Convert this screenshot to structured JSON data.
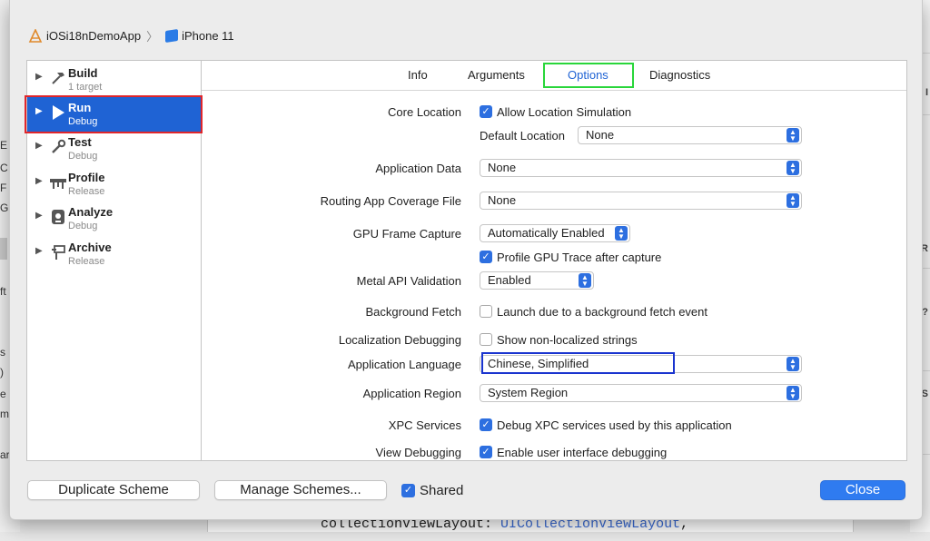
{
  "breadcrumb": {
    "project": "iOSi18nDemoApp",
    "device": "iPhone 11"
  },
  "sidebar": {
    "actions": [
      {
        "name": "Build",
        "sub": "1 target",
        "icon": "hammer-icon"
      },
      {
        "name": "Run",
        "sub": "Debug",
        "icon": "play-icon",
        "selected": true
      },
      {
        "name": "Test",
        "sub": "Debug",
        "icon": "wrench-icon"
      },
      {
        "name": "Profile",
        "sub": "Release",
        "icon": "caliper-icon"
      },
      {
        "name": "Analyze",
        "sub": "Debug",
        "icon": "analyze-icon"
      },
      {
        "name": "Archive",
        "sub": "Release",
        "icon": "archive-icon"
      }
    ]
  },
  "tabs": {
    "info": "Info",
    "arguments": "Arguments",
    "options": "Options",
    "diagnostics": "Diagnostics",
    "active": "Options"
  },
  "options": {
    "core_location": {
      "label": "Core Location",
      "checkbox": "Allow Location Simulation",
      "checked": true
    },
    "default_location": {
      "label": "Default Location",
      "value": "None"
    },
    "application_data": {
      "label": "Application Data",
      "value": "None"
    },
    "routing": {
      "label": "Routing App Coverage File",
      "value": "None"
    },
    "gpu_frame_capture": {
      "label": "GPU Frame Capture",
      "value": "Automatically Enabled"
    },
    "profile_gpu": {
      "checkbox": "Profile GPU Trace after capture",
      "checked": true
    },
    "metal_api": {
      "label": "Metal API Validation",
      "value": "Enabled"
    },
    "background_fetch": {
      "label": "Background Fetch",
      "checkbox": "Launch due to a background fetch event",
      "checked": false
    },
    "localization_debugging": {
      "label": "Localization Debugging",
      "checkbox": "Show non-localized strings",
      "checked": false
    },
    "application_language": {
      "label": "Application Language",
      "value": "Chinese, Simplified"
    },
    "application_region": {
      "label": "Application Region",
      "value": "System Region"
    },
    "xpc_services": {
      "label": "XPC Services",
      "checkbox": "Debug XPC services used by this application",
      "checked": true
    },
    "view_debugging": {
      "label": "View Debugging",
      "checkbox": "Enable user interface debugging",
      "checked": true
    }
  },
  "footer": {
    "duplicate": "Duplicate Scheme",
    "manage": "Manage Schemes...",
    "shared": "Shared",
    "shared_checked": true,
    "close": "Close"
  },
  "background": {
    "code_param": "collectionViewLayout:",
    "code_type": "UICollectionViewLayout",
    "code_tail": ","
  },
  "colors": {
    "accent": "#1f63d4",
    "highlight_red": "#e0262b",
    "highlight_green": "#29d63a",
    "highlight_blue": "#1a34cf",
    "close_button": "#2f7bf0"
  }
}
